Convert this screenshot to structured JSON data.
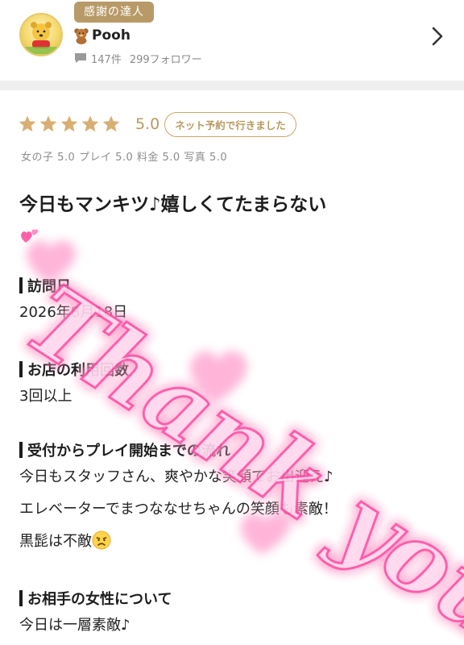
{
  "profile": {
    "badge": "感謝の達人",
    "username": "Pooh",
    "post_count": "147件",
    "followers": "299フォロワー",
    "avatar_icon": "pooh-avatar-icon",
    "name_icon": "teddy-bear-icon"
  },
  "review": {
    "stars": 5,
    "score": "5.0",
    "visit_tag": "ネット予約で行きました",
    "sub_ratings": "女の子 5.0  プレイ 5.0  料金 5.0  写真 5.0",
    "title": "今日もマンキツ♪嬉しくてたまらない",
    "title_emoji": "two-hearts-icon",
    "sections": [
      {
        "heading": "訪問日",
        "lines": [
          "2026年8月18日"
        ]
      },
      {
        "heading": "お店の利用回数",
        "lines": [
          "3回以上"
        ]
      },
      {
        "heading": "受付からプレイ開始までの流れ",
        "lines": [
          "今日もスタッフさん、爽やかな笑顔でお出迎え♪",
          "エレベーターでまつななせちゃんの笑顔も素敵！",
          "黒髭は不敵"
        ]
      },
      {
        "heading": "お相手の女性について",
        "lines": [
          "今日は一層素敵♪"
        ]
      }
    ]
  },
  "watermark": {
    "text": "Thank you"
  },
  "colors": {
    "gold": "#b89a62",
    "star": "#d9ae72",
    "badge": "#b79a67",
    "pink": "#ff6fb5"
  }
}
